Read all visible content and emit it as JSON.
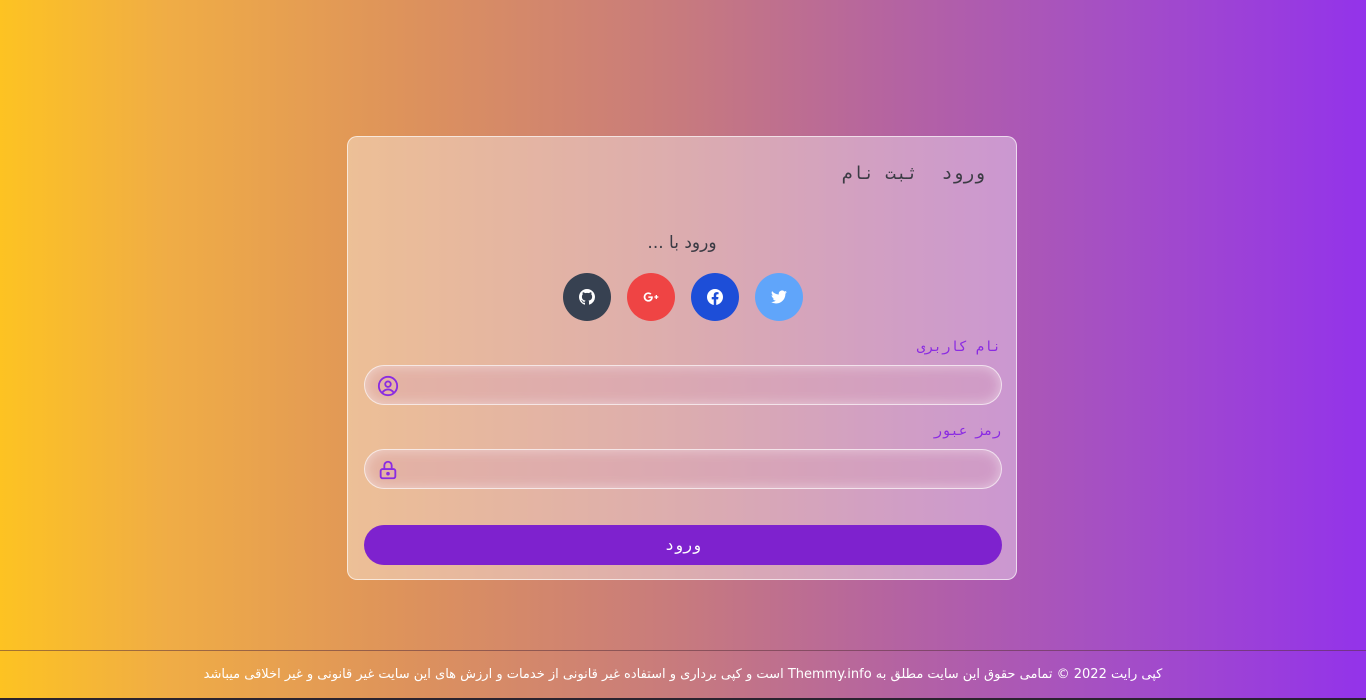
{
  "tabs": {
    "login": "ورود",
    "register": "ثبت نام"
  },
  "login_with": "ورود با ...",
  "socials": [
    {
      "name": "twitter",
      "icon": "twitter-icon",
      "color": "#60a5fa"
    },
    {
      "name": "facebook",
      "icon": "facebook-icon",
      "color": "#1d4ed8"
    },
    {
      "name": "google-plus",
      "icon": "google-plus-icon",
      "color": "#ef4444"
    },
    {
      "name": "github",
      "icon": "github-icon",
      "color": "#374151"
    }
  ],
  "form": {
    "username_label": "نام کاربری",
    "username_value": "",
    "password_label": "رمز عبور",
    "password_value": "",
    "submit_label": "ورود"
  },
  "footer": {
    "text": "کپی رایت 2022 © تمامی حقوق این سایت مطلق به Themmy.info است و کپی برداری و استفاده غیر قانونی از خدمات و ارزش های این سایت غیر قانونی و غیر اخلاقی میباشد"
  },
  "colors": {
    "accent": "#7e22ce",
    "label": "#8a2be2"
  }
}
